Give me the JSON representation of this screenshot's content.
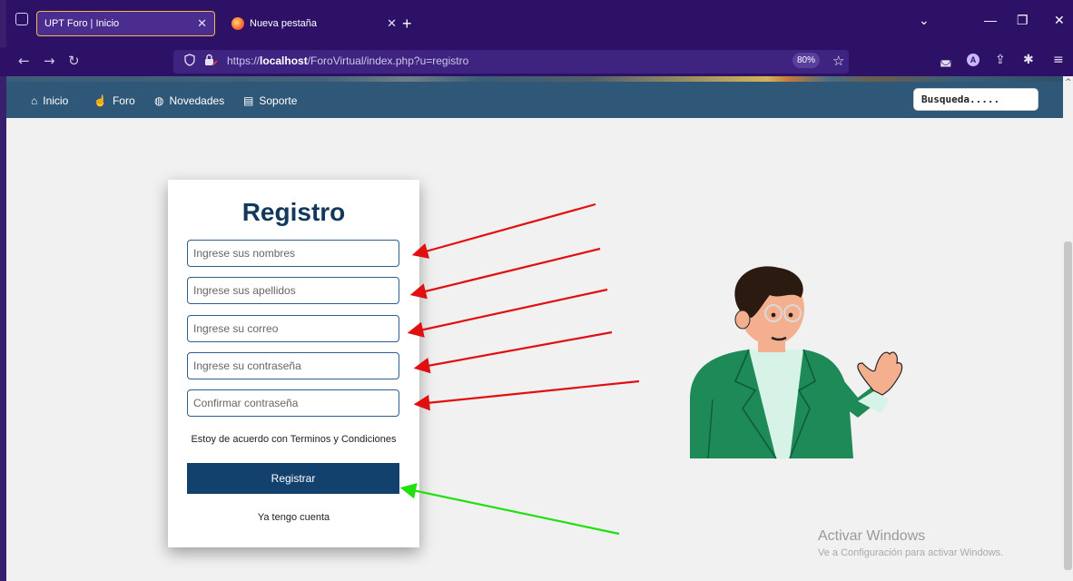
{
  "browser": {
    "tabs": [
      {
        "title": "UPT Foro | Inicio",
        "active": true
      },
      {
        "title": "Nueva pestaña",
        "active": false
      }
    ],
    "url_prefix": "https://",
    "url_host": "localhost",
    "url_path": "/ForoVirtual/index.php?u=registro",
    "zoom": "80%",
    "profile_initial": "A"
  },
  "site_nav": {
    "items": [
      {
        "label": "Inicio",
        "icon": "home-icon"
      },
      {
        "label": "Foro",
        "icon": "hand-icon"
      },
      {
        "label": "Novedades",
        "icon": "globe-icon"
      },
      {
        "label": "Soporte",
        "icon": "support-icon"
      }
    ],
    "search_placeholder": "Busqueda....."
  },
  "form": {
    "title": "Registro",
    "fields": [
      {
        "placeholder": "Ingrese sus nombres"
      },
      {
        "placeholder": "Ingrese sus apellidos"
      },
      {
        "placeholder": "Ingrese su correo"
      },
      {
        "placeholder": "Ingrese su contraseña"
      },
      {
        "placeholder": "Confirmar contraseña"
      }
    ],
    "terms": "Estoy de acuerdo con Terminos y Condiciones",
    "submit": "Registrar",
    "login_link": "Ya tengo cuenta"
  },
  "watermark": {
    "title": "Activar Windows",
    "subtitle": "Ve a Configuración para activar Windows."
  },
  "colors": {
    "browser_chrome": "#2d1166",
    "site_nav": "#2f5878",
    "button": "#12416d",
    "title": "#12385b",
    "arrow_red": "#e01010",
    "arrow_green": "#22e010"
  }
}
